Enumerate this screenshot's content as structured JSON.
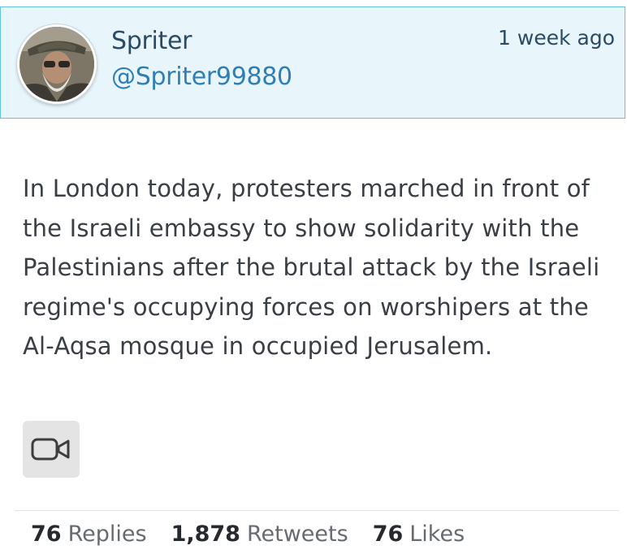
{
  "author": {
    "display_name": "Spriter",
    "handle": "@Spriter99880",
    "avatar_icon": "user-avatar-photo"
  },
  "timestamp": "1 week ago",
  "tweet": {
    "text": "In London today, protesters marched in front of the Israeli embassy to show solidarity with the Palestinians after the brutal attack by the Israeli regime's occupying forces on worshipers at the Al-Aqsa mosque in occupied Jerusalem."
  },
  "media": {
    "icon": "video-camera-icon"
  },
  "stats": {
    "replies_count": "76",
    "replies_label": "Replies",
    "retweets_count": "1,878",
    "retweets_label": "Retweets",
    "likes_count": "76",
    "likes_label": "Likes"
  },
  "colors": {
    "header_bg": "#e8f6fc",
    "header_border": "#63c3e6",
    "name": "#2b4a66",
    "handle": "#2f7fb5",
    "text": "#3a3f46"
  }
}
